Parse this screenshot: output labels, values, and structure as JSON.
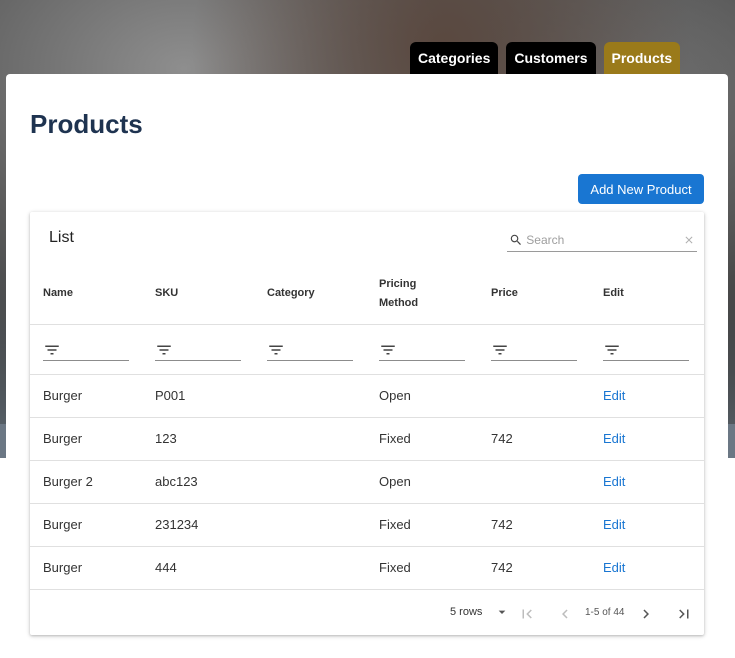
{
  "nav": {
    "tabs": [
      {
        "label": "Categories",
        "active": false
      },
      {
        "label": "Customers",
        "active": false
      },
      {
        "label": "Products",
        "active": true
      }
    ]
  },
  "page": {
    "title": "Products"
  },
  "actions": {
    "add_label": "Add New Product"
  },
  "list": {
    "title": "List",
    "search": {
      "placeholder": "Search",
      "value": ""
    },
    "columns": [
      "Name",
      "SKU",
      "Category",
      "Pricing Method",
      "Price",
      "Edit"
    ],
    "rows": [
      {
        "name": "Burger",
        "sku": "P001",
        "category": "",
        "pricing": "Open",
        "price": "",
        "edit": "Edit"
      },
      {
        "name": "Burger",
        "sku": "123",
        "category": "",
        "pricing": "Fixed",
        "price": "742",
        "edit": "Edit"
      },
      {
        "name": "Burger 2",
        "sku": "abc123",
        "category": "",
        "pricing": "Open",
        "price": "",
        "edit": "Edit"
      },
      {
        "name": "Burger",
        "sku": "231234",
        "category": "",
        "pricing": "Fixed",
        "price": "742",
        "edit": "Edit"
      },
      {
        "name": "Burger",
        "sku": "444",
        "category": "",
        "pricing": "Fixed",
        "price": "742",
        "edit": "Edit"
      }
    ],
    "pagination": {
      "rows_per_page": "5 rows",
      "range": "1-5 of 44"
    }
  },
  "colors": {
    "accent": "#1976d2",
    "active_tab": "#9a7a1a",
    "title": "#1e3350"
  }
}
